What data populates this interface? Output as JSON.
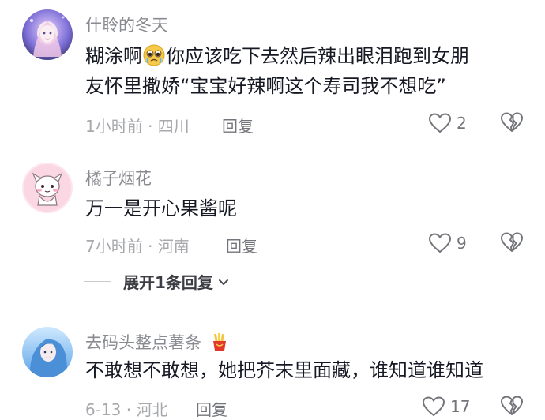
{
  "comments": [
    {
      "username": "什聆的冬天",
      "line1_a": "糊涂啊",
      "emoji1": "crying-pleading-emoji",
      "line1_b": "你应该吃下去然后辣出眼泪跑到女朋",
      "line2": "友怀里撒娇“宝宝好辣啊这个寿司我不想吃”",
      "time_location": "1小时前 · 四川",
      "reply_label": "回复",
      "likes": "2"
    },
    {
      "username": "橘子烟花",
      "line1": "万一是开心果酱呢",
      "time_location": "7小时前 · 河南",
      "reply_label": "回复",
      "likes": "9",
      "expand_label": "展开1条回复"
    },
    {
      "username": "去码头整点薯条",
      "username_emoji": "french-fries-emoji",
      "line1": "不敢想不敢想，她把芥末里面藏，谁知道谁知道",
      "time_location": "6-13 · 河北",
      "reply_label": "回复",
      "likes": "17"
    }
  ],
  "colors": {
    "text": "#161823",
    "meta": "#a8a9ad",
    "username": "#8a8b91",
    "icon": "#74757a"
  }
}
